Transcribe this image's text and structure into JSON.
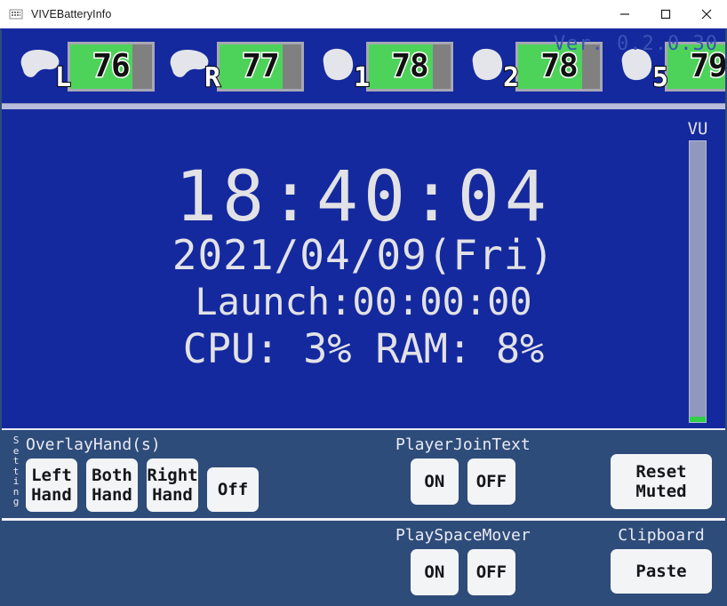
{
  "window": {
    "title": "VIVEBatteryInfo",
    "icon": "app-icon",
    "controls": {
      "minimize": "–",
      "maximize": "□",
      "close": "✕"
    }
  },
  "colors": {
    "background": "#14299e",
    "panel": "#2e4c7a",
    "battery_fill": "#4dd35a",
    "battery_empty": "#808080",
    "button": "#f3f4f6",
    "text": "#e2e2e6",
    "version_text": "#3b52b8",
    "separator": "#b9bddc",
    "vu_track": "#9098bd",
    "vu_level": "#2fcf46"
  },
  "battery_bar": {
    "version": "Ver. 0.2.0.30",
    "devices": [
      {
        "label": "L",
        "icon": "controller-icon",
        "percent": "76",
        "fill": 76
      },
      {
        "label": "R",
        "icon": "controller-icon",
        "percent": "77",
        "fill": 77
      },
      {
        "label": "1",
        "icon": "tracker-icon",
        "percent": "78",
        "fill": 78
      },
      {
        "label": "2",
        "icon": "tracker-icon",
        "percent": "78",
        "fill": 78
      },
      {
        "label": "5",
        "icon": "tracker-icon",
        "percent": "79",
        "fill": 79
      }
    ]
  },
  "clock": {
    "time": "18:40:04",
    "date": "2021/04/09(Fri)",
    "launch": "Launch:00:00:00",
    "stats": "CPU:  3%  RAM:  8%",
    "cpu_percent": "3%",
    "ram_percent": "8%"
  },
  "vu_meter": {
    "label": "VU",
    "level": 2
  },
  "settings": {
    "section_label": [
      "S",
      "e",
      "t",
      "t",
      "i",
      "n",
      "g"
    ],
    "groups": [
      {
        "title": "OverlayHand(s)",
        "buttons": [
          {
            "line1": "Left",
            "line2": "Hand"
          },
          {
            "line1": "Both",
            "line2": "Hand"
          },
          {
            "line1": "Right",
            "line2": "Hand"
          },
          {
            "line1": "Off",
            "line2": ""
          }
        ]
      },
      {
        "title": "PlayerJoinText",
        "buttons": [
          {
            "line1": "ON",
            "line2": ""
          },
          {
            "line1": "OFF",
            "line2": ""
          }
        ]
      },
      {
        "title": "",
        "buttons": [
          {
            "line1": "Reset",
            "line2": "Muted"
          }
        ]
      },
      {
        "title": "PlaySpaceMover",
        "buttons": [
          {
            "line1": "ON",
            "line2": ""
          },
          {
            "line1": "OFF",
            "line2": ""
          }
        ]
      },
      {
        "title": "Clipboard",
        "buttons": [
          {
            "line1": "Paste",
            "line2": ""
          }
        ]
      }
    ]
  }
}
